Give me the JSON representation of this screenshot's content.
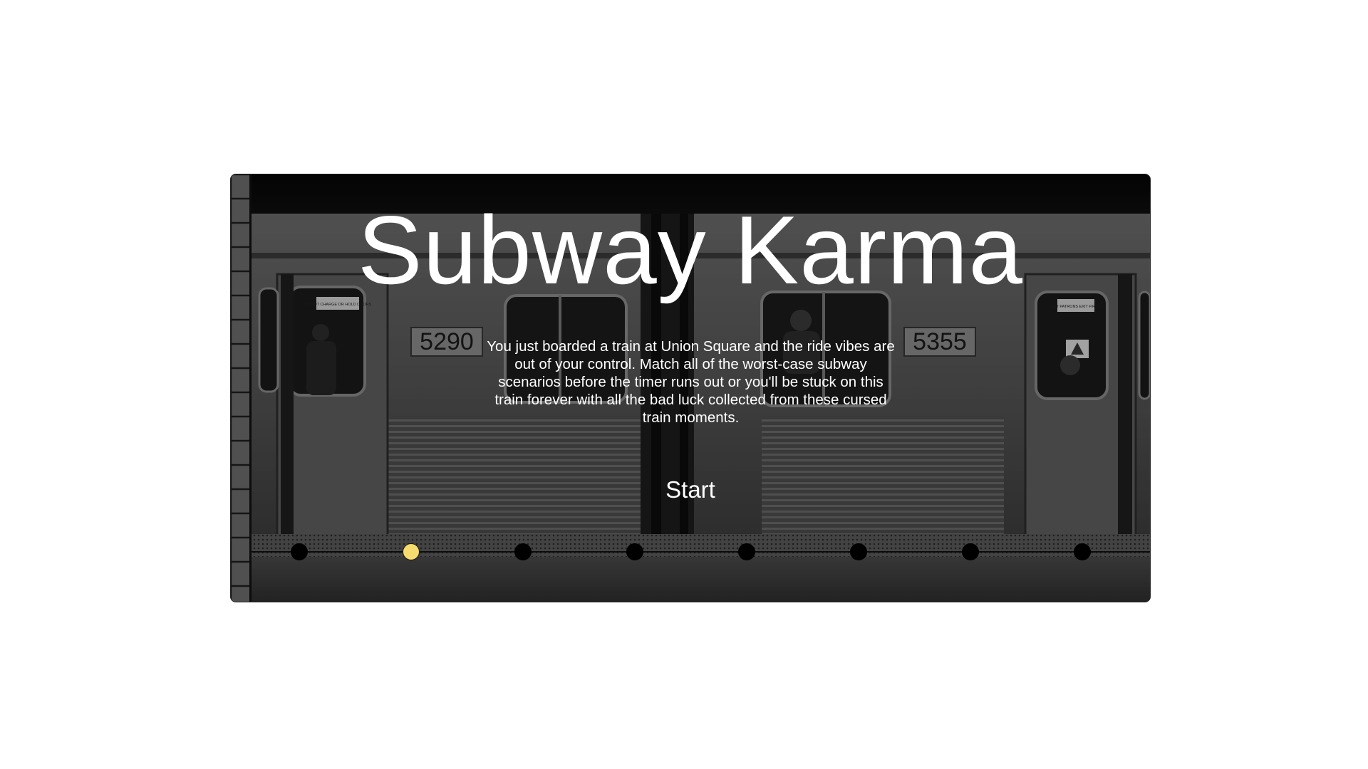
{
  "game": {
    "title": "Subway Karma",
    "description": "You just boarded a train at Union Square and the ride vibes are out of your control. Match all of the worst-case subway scenarios before the timer runs out or you'll be stuck on this train forever with all the bad luck collected from these cursed train moments.",
    "start_label": "Start"
  },
  "train": {
    "car_number_left": "5290",
    "car_number_right": "5355",
    "sign_left": "DO NOT CHARGE OR HOLD DOORS",
    "sign_right": "LET PATRONS EXIT FIRST"
  },
  "progress": {
    "stops_total": 8,
    "current_stop": 2
  },
  "colors": {
    "active_stop": "#f6dc6e",
    "inactive_stop": "#000000",
    "text": "#ffffff"
  }
}
